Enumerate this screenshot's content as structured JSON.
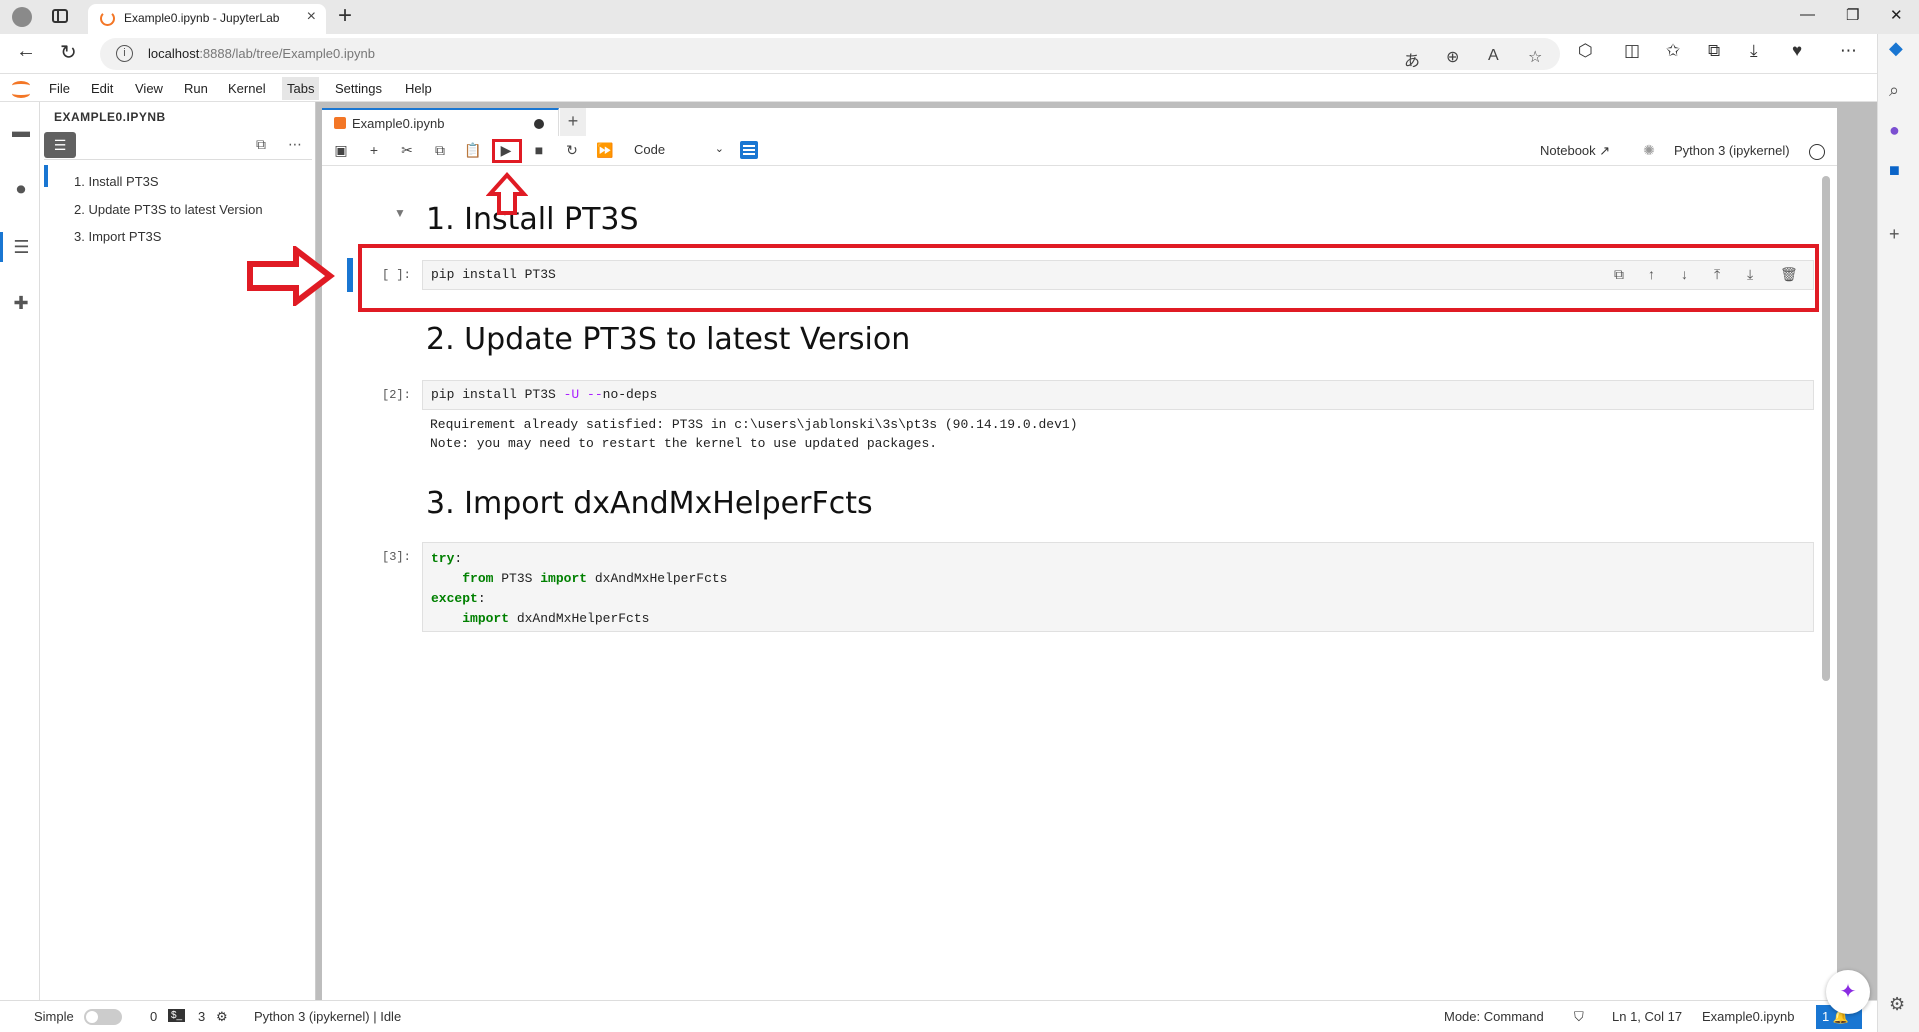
{
  "browser": {
    "tab_title": "Example0.ipynb - JupyterLab",
    "url_host": "localhost",
    "url_rest": ":8888/lab/tree/Example0.ipynb"
  },
  "menu": [
    "File",
    "Edit",
    "View",
    "Run",
    "Kernel",
    "Tabs",
    "Settings",
    "Help"
  ],
  "left_panel": {
    "title": "EXAMPLE0.IPYNB",
    "toc": [
      "1. Install PT3S",
      "2. Update PT3S to latest Version",
      "3. Import PT3S"
    ]
  },
  "notebook": {
    "tab_name": "Example0.ipynb",
    "cell_type": "Code",
    "open_notebook_label": "Notebook",
    "kernel_label": "Python 3 (ipykernel)",
    "h1_install": "1. Install PT3S",
    "cell1_prompt": "[ ]:",
    "cell1_code": "pip install PT3S",
    "h2_update": "2. Update PT3S to latest Version",
    "cell2_prompt": "[2]:",
    "cell2_code_a": "pip install PT3S ",
    "cell2_code_b": "-U ",
    "cell2_code_c": "--",
    "cell2_code_d": "no-deps",
    "cell2_output": "Requirement already satisfied: PT3S in c:\\users\\jablonski\\3s\\pt3s (90.14.19.0.dev1)\nNote: you may need to restart the kernel to use updated packages.",
    "h3_import": "3. Import dxAndMxHelperFcts",
    "cell3_prompt": "[3]:",
    "cell3_try": "try",
    "cell3_from": "from",
    "cell3_mod": " PT3S ",
    "cell3_import": "import",
    "cell3_name": " dxAndMxHelperFcts",
    "cell3_except": "except",
    "cell3_import2": "import",
    "cell3_name2": " dxAndMxHelperFcts"
  },
  "status": {
    "mode_label": "Simple",
    "terminals": "0",
    "kernels": "3",
    "kernel_status": "Python 3 (ipykernel) | Idle",
    "mode": "Mode: Command",
    "position": "Ln 1, Col 17",
    "file": "Example0.ipynb",
    "notifications": "1"
  },
  "colors": {
    "accent": "#1976d2",
    "annotation": "#e01b24",
    "jupyter_orange": "#f37626"
  }
}
